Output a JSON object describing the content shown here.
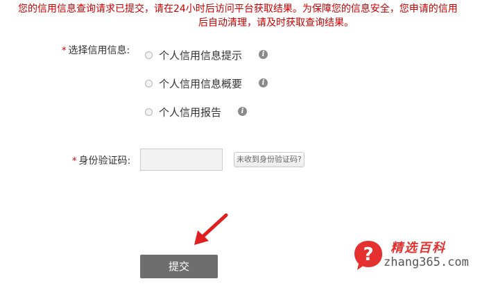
{
  "notice": {
    "line1": "您的信用信息查询请求已提交，请在24小时后访问平台获取结果。为保障您的信息安全，您申请的信用",
    "line2": "后自动清理，请及时获取查询结果。"
  },
  "form": {
    "required_mark": "*",
    "credit_info_label": "选择信用信息:",
    "options": [
      {
        "label": "个人信用信息提示"
      },
      {
        "label": "个人信用信息概要"
      },
      {
        "label": "个人信用报告"
      }
    ],
    "info_icon_glyph": "i",
    "code_label": "身份验证码:",
    "code_value": "",
    "resend_label": "未收到身份验证码?",
    "submit_label": "提交"
  },
  "watermark": {
    "title": "精选百科",
    "url": "zhang365.com",
    "logo_glyph": "?"
  },
  "colors": {
    "notice": "#cc0000",
    "submit_bg": "#6e6e6e",
    "arrow": "#e02020",
    "watermark_red": "#e53030"
  }
}
